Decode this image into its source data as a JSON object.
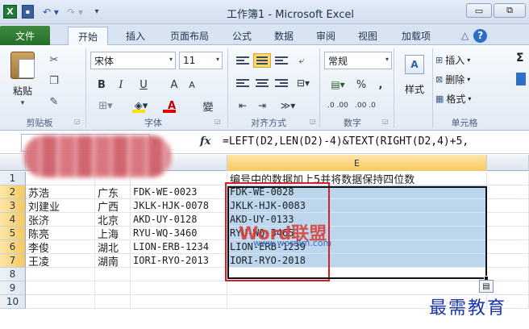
{
  "window": {
    "title": "工作簿1 - Microsoft Excel",
    "logo": "X",
    "minimize": "▭",
    "restore": "⧉"
  },
  "tabs": {
    "file": "文件",
    "home": "开始",
    "insert": "插入",
    "layout": "页面布局",
    "formula": "公式",
    "data": "数据",
    "review": "审阅",
    "view": "视图",
    "addin": "加载项"
  },
  "ribbon": {
    "clipboard": {
      "paste": "粘贴",
      "group_label": "剪贴板"
    },
    "font": {
      "name": "宋体",
      "size": "11",
      "bold": "B",
      "italic": "I",
      "underline": "U",
      "grow": "A",
      "shrink": "A",
      "color": "A",
      "phonetic": "變",
      "group_label": "字体"
    },
    "alignment": {
      "group_label": "对齐方式"
    },
    "number": {
      "format": "常规",
      "percent": "%",
      "comma": ",",
      "dec_inc": ".0 .00",
      "dec_dec": ".00 .0",
      "group_label": "数字"
    },
    "styles": {
      "style": "样式"
    },
    "cells": {
      "insert": "插入",
      "delete": "删除",
      "format": "格式",
      "group_label": "单元格"
    }
  },
  "formula_bar": {
    "fx": "fx",
    "formula": "=LEFT(D2,LEN(D2)-4)&TEXT(RIGHT(D2,4)+5,"
  },
  "sheet": {
    "columns": [
      "E"
    ],
    "header_row": {
      "row": "1",
      "e": "编号中的数据加上5并将数据保持四位数"
    },
    "rows": [
      {
        "row": "2",
        "b": "苏浩",
        "c": "广东",
        "d": "FDK-WE-0023",
        "e": "FDK-WE-0028"
      },
      {
        "row": "3",
        "b": "刘建业",
        "c": "广西",
        "d": "JKLK-HJK-0078",
        "e": "JKLK-HJK-0083"
      },
      {
        "row": "4",
        "b": "张济",
        "c": "北京",
        "d": "AKD-UY-0128",
        "e": "AKD-UY-0133"
      },
      {
        "row": "5",
        "b": "陈亮",
        "c": "上海",
        "d": "RYU-WQ-3460",
        "e": "RYU-WQ-3465"
      },
      {
        "row": "6",
        "b": "李俊",
        "c": "湖北",
        "d": "LION-ERB-1234",
        "e": "LION-ERB-1239"
      },
      {
        "row": "7",
        "b": "王凌",
        "c": "湖南",
        "d": "IORI-RYO-2013",
        "e": "IORI-RYO-2018"
      }
    ],
    "empty_rows": [
      "8",
      "9",
      "10"
    ]
  },
  "watermark": {
    "text": "Word联盟",
    "url": "www.wordlm.com"
  },
  "site_logo": "最需教育"
}
